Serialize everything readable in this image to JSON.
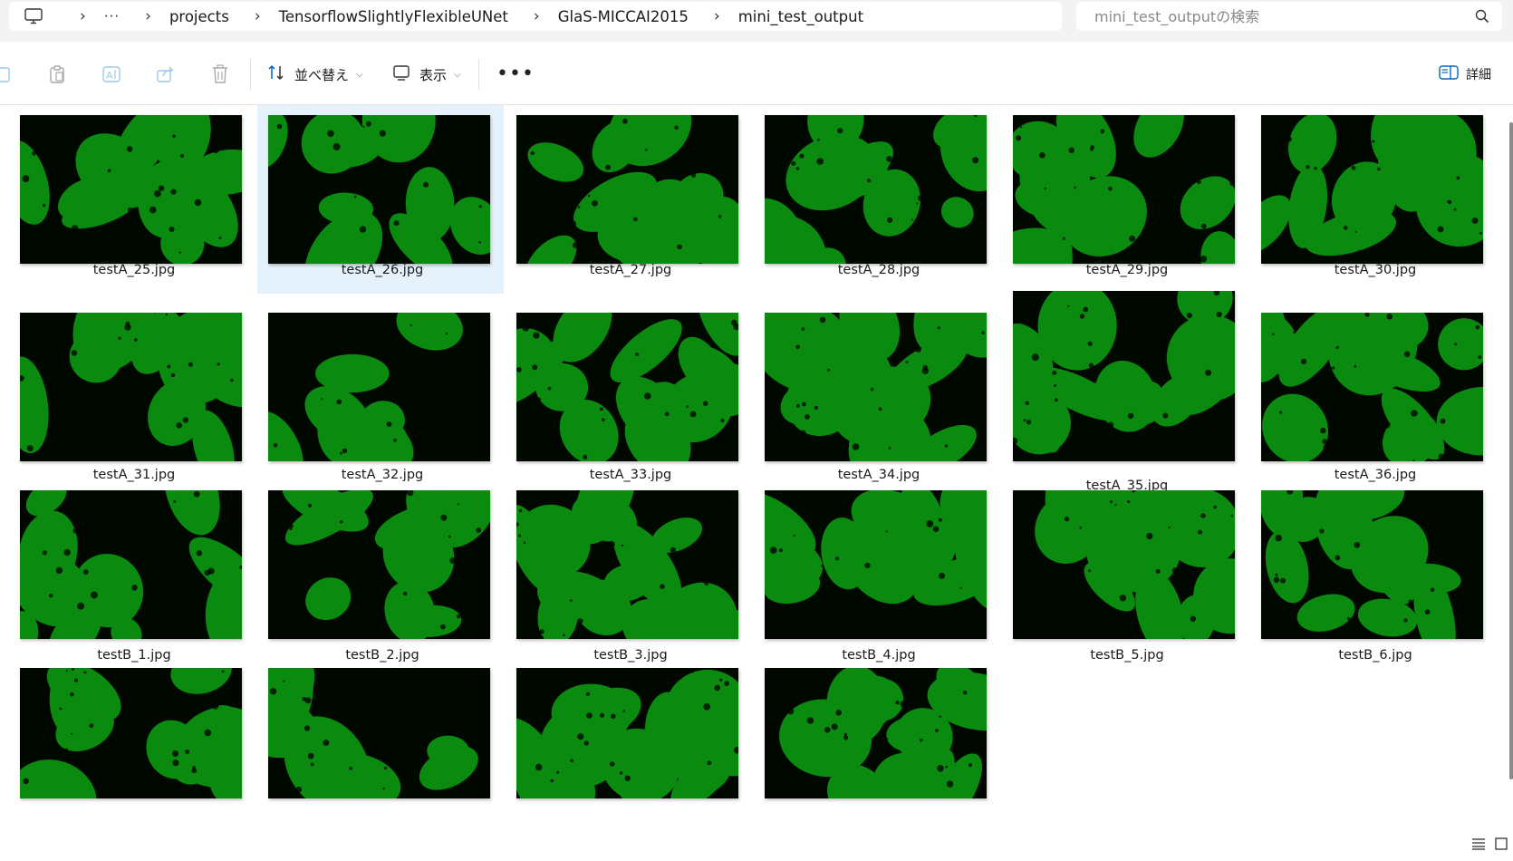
{
  "breadcrumb": {
    "items": [
      "projects",
      "TensorflowSlightlyFlexibleUNet",
      "GlaS-MICCAI2015",
      "mini_test_output"
    ],
    "overflow": "···"
  },
  "search": {
    "placeholder": "mini_test_outputの検索"
  },
  "toolbar": {
    "sort_label": "並べ替え",
    "view_label": "表示",
    "details_label": "詳細"
  },
  "colors": {
    "thumb_green": "#0b8a10",
    "thumb_dark": "#000800",
    "selection": "#e5f1fb",
    "accent": "#0067c0"
  },
  "files": [
    "testA_25.jpg",
    "testA_26.jpg",
    "testA_27.jpg",
    "testA_28.jpg",
    "testA_29.jpg",
    "testA_30.jpg",
    "testA_31.jpg",
    "testA_32.jpg",
    "testA_33.jpg",
    "testA_34.jpg",
    "testA_35.jpg",
    "testA_36.jpg",
    "testB_1.jpg",
    "testB_2.jpg",
    "testB_3.jpg",
    "testB_4.jpg",
    "testB_5.jpg",
    "testB_6.jpg",
    "",
    "",
    "",
    ""
  ],
  "selected_index": 1
}
